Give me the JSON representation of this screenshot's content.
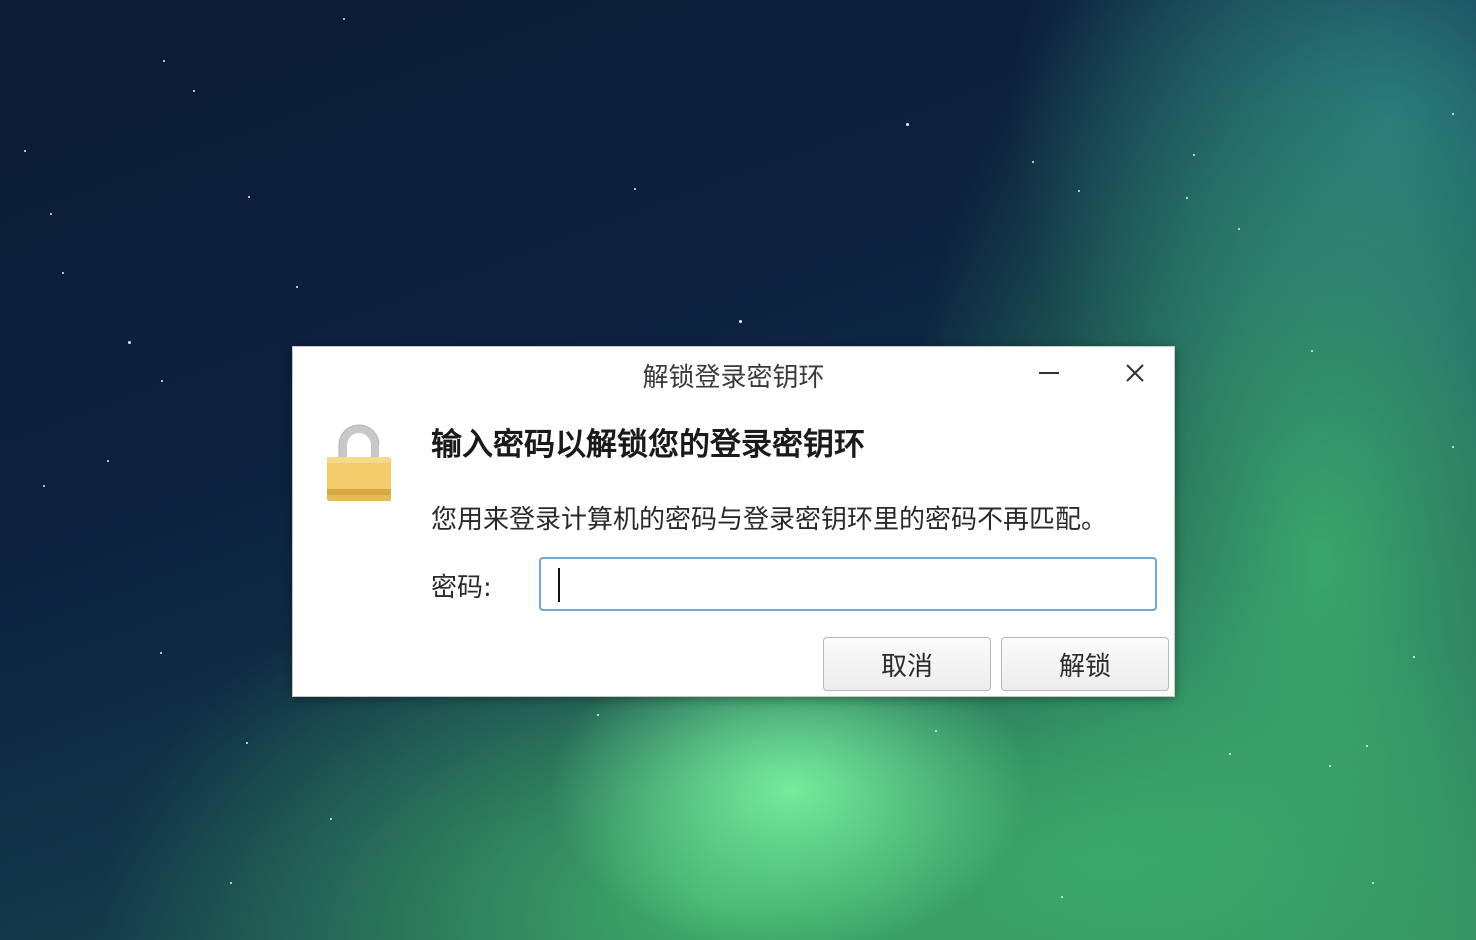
{
  "window": {
    "title": "解锁登录密钥环",
    "minimize_icon": "minimize-icon",
    "close_icon": "close-icon"
  },
  "dialog": {
    "icon": "lock-icon",
    "heading": "输入密码以解锁您的登录密钥环",
    "message": "您用来登录计算机的密码与登录密钥环里的密码不再匹配。",
    "password_label": "密码:",
    "password_value": "",
    "cancel_label": "取消",
    "unlock_label": "解锁"
  },
  "colors": {
    "input_focus_border": "#6fa8dc",
    "lock_body": "#f2cb6b",
    "lock_shackle": "#c8c8c8"
  }
}
